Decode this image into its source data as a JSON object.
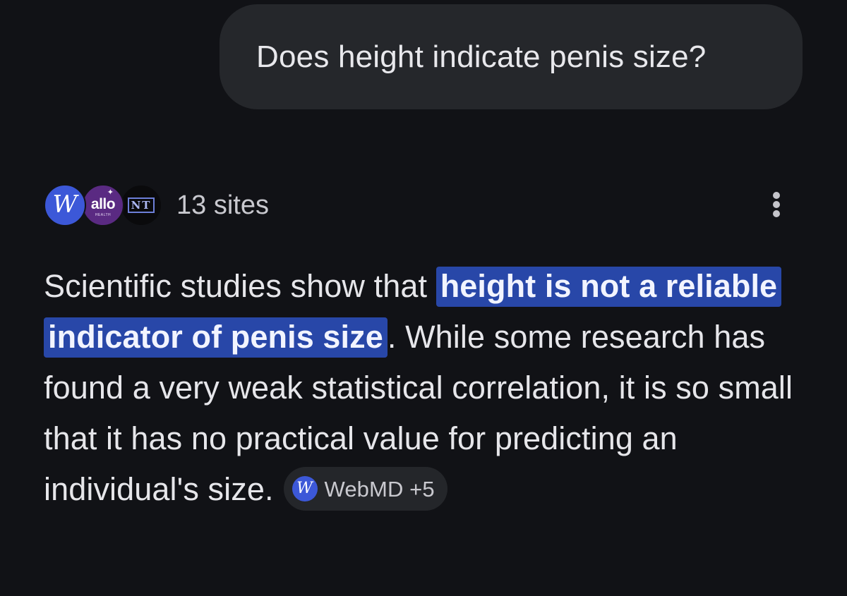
{
  "user_query": {
    "text": "Does height indicate penis size?"
  },
  "sources": {
    "logos": [
      {
        "name": "WebMD",
        "letter": "W",
        "color": "#3c58d8"
      },
      {
        "name": "allo health",
        "word": "allo",
        "sub": "HEALTH",
        "color": "#5a2a82"
      },
      {
        "name": "NT",
        "letters": "NT",
        "color": "#0a0a0c"
      }
    ],
    "count_label": "13 sites"
  },
  "answer": {
    "intro": "Scientific studies show that",
    "highlight": "height is not a reliable indicator of penis size",
    "rest": ". While some research has found a very weak statistical correlation, it is so small that it has no practical value for predicting an individual's size.",
    "citation": {
      "icon_letter": "W",
      "label": "WebMD +5"
    }
  },
  "colors": {
    "background": "#111216",
    "bubble": "#25272b",
    "highlight": "#2847a8",
    "chip": "#24262a"
  },
  "icons": {
    "more_menu": "more-vertical-icon"
  }
}
